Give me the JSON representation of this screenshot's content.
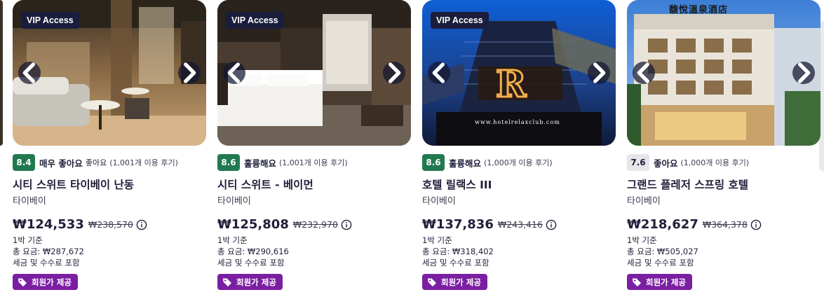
{
  "cards": [
    {
      "badge": "VIP Access",
      "score": "8.4",
      "rating_word": "매우 좋아요",
      "rating_sub": "좋아요",
      "reviews": "(1,001개 이용 후기)",
      "name": "시티 스위트 타이베이 난동",
      "city": "타이베이",
      "price": "₩124,533",
      "original_price": "₩238,570",
      "per_night": "1박 기준",
      "total": "총 요금: ₩287,672",
      "taxes": "세금 및 수수료 포함",
      "member_price": "회원가 제공"
    },
    {
      "badge": "VIP Access",
      "score": "8.6",
      "rating_word": "훌륭해요",
      "rating_sub": "",
      "reviews": "(1,001개 이용 후기)",
      "name": "시티 스위트 - 베이먼",
      "city": "타이베이",
      "price": "₩125,808",
      "original_price": "₩232,970",
      "per_night": "1박 기준",
      "total": "총 요금: ₩290,616",
      "taxes": "세금 및 수수료 포함",
      "member_price": "회원가 제공"
    },
    {
      "badge": "VIP Access",
      "score": "8.6",
      "rating_word": "훌륭해요",
      "rating_sub": "",
      "reviews": "(1,000개 이용 후기)",
      "name": "호텔 릴랙스 III",
      "city": "타이베이",
      "price": "₩137,836",
      "original_price": "₩243,416",
      "per_night": "1박 기준",
      "total": "총 요금: ₩318,402",
      "taxes": "세금 및 수수료 포함",
      "member_price": "회원가 제공",
      "photo_text": "www.hotelrelaxclub.com"
    },
    {
      "score": "7.6",
      "rating_word": "좋아요",
      "rating_sub": "",
      "reviews": "(1,000개 이용 후기)",
      "name": "그랜드 플레저 스프링 호텔",
      "city": "타이베이",
      "price": "₩218,627",
      "original_price": "₩364,378",
      "per_night": "1박 기준",
      "total": "총 요금: ₩505,027",
      "taxes": "세금 및 수수료 포함",
      "member_price": "회원가 제공",
      "photo_text": "馥悅溫泉酒店"
    }
  ],
  "icons": {
    "prev": "chevron-left-icon",
    "next": "chevron-right-icon",
    "info": "info-icon",
    "tag": "tag-icon"
  },
  "colors": {
    "score_green": "#227950",
    "score_grey": "#e4e6ea",
    "vip_badge": "#1a1d3b",
    "member_badge": "#7b1fa2",
    "text": "#1f1f3a"
  }
}
